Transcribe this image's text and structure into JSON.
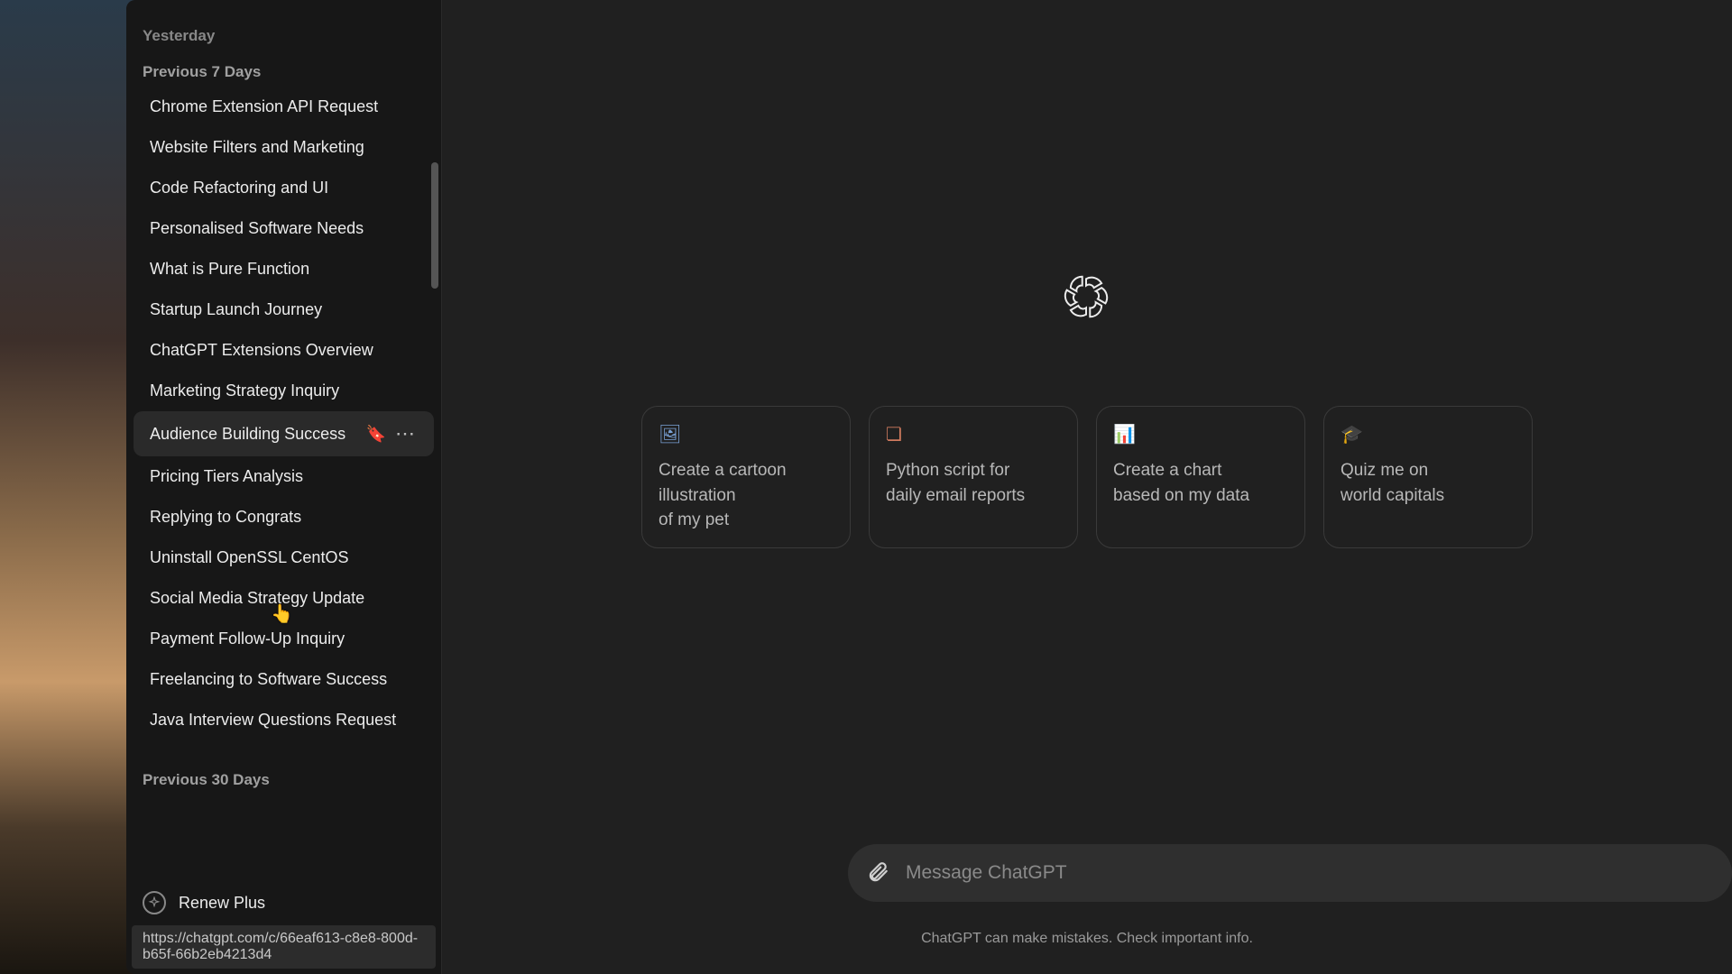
{
  "header_title": "",
  "sidebar": {
    "yesterday_label": "Yesterday",
    "section_7days": "Previous 7 Days",
    "section_30days": "Previous 30 Days",
    "items": [
      {
        "title": "Chrome Extension API Request"
      },
      {
        "title": "Website Filters and Marketing"
      },
      {
        "title": "Code Refactoring and UI"
      },
      {
        "title": "Personalised Software Needs"
      },
      {
        "title": "What is Pure Function"
      },
      {
        "title": "Startup Launch Journey"
      },
      {
        "title": "ChatGPT Extensions Overview"
      },
      {
        "title": "Marketing Strategy Inquiry"
      },
      {
        "title": "Audience Building Success"
      },
      {
        "title": "Pricing Tiers Analysis"
      },
      {
        "title": "Replying to Congrats"
      },
      {
        "title": "Uninstall OpenSSL CentOS"
      },
      {
        "title": "Social Media Strategy Update"
      },
      {
        "title": "Payment Follow-Up Inquiry"
      },
      {
        "title": "Freelancing to Software Success"
      },
      {
        "title": "Java Interview Questions Request"
      }
    ],
    "renew_label": "Renew Plus"
  },
  "status_url": "https://chatgpt.com/c/66eaf613-c8e8-800d-b65f-66b2eb4213d4",
  "suggestions": [
    {
      "icon": "image-icon",
      "icon_glyph": "🖼",
      "icon_color": "#7aa2d6",
      "text": "Create a cartoon\nillustration\nof my pet"
    },
    {
      "icon": "code-icon",
      "icon_glyph": "❏",
      "icon_color": "#cf7a5e",
      "text": "Python script for\ndaily email reports"
    },
    {
      "icon": "chart-icon",
      "icon_glyph": "📊",
      "icon_color": "#6ea8c4",
      "text": "Create a chart\nbased on my data"
    },
    {
      "icon": "cap-icon",
      "icon_glyph": "🎓",
      "icon_color": "#6aa5c9",
      "text": "Quiz me on\nworld capitals"
    }
  ],
  "input": {
    "placeholder": "Message ChatGPT"
  },
  "disclaimer": "ChatGPT can make mistakes. Check important info."
}
